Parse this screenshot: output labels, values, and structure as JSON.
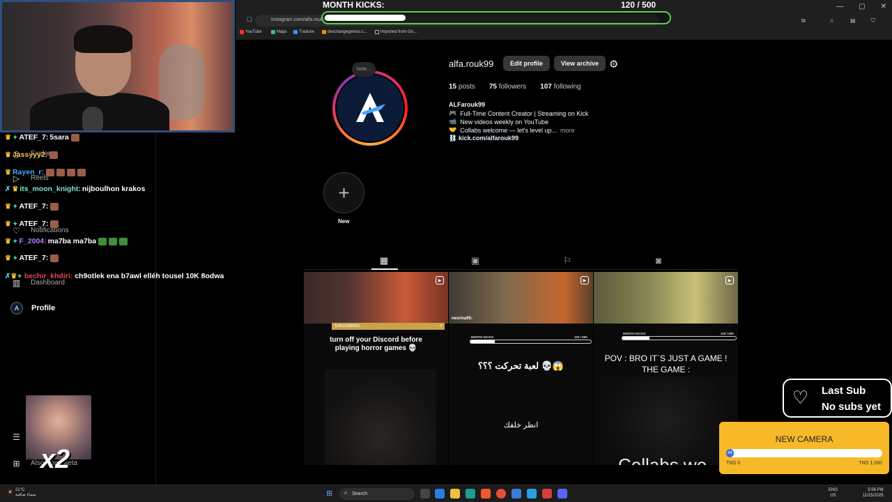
{
  "browser": {
    "url": "instagram.com/alfa.rouk99",
    "bookmarks": [
      "YouTube",
      "Maps",
      "Traduire",
      "dexchangegenius.c...",
      "Imported from Go..."
    ]
  },
  "month_kicks": {
    "label": "MONTH KICKS:",
    "count_text": "120 / 500",
    "current": 120,
    "goal": 500
  },
  "chat": [
    {
      "user": "ATEF_7:",
      "user_color": "#ffffff",
      "msg": "5sara"
    },
    {
      "user": "Jassyyy2:",
      "user_color": "#f0c14b",
      "msg": ""
    },
    {
      "user": "Rayen_r:",
      "user_color": "#4aa8ff",
      "msg": ""
    },
    {
      "user": "its_moon_knight:",
      "user_color": "#79e6d0",
      "msg": "nijboulhon krakos"
    },
    {
      "user": "ATEF_7:",
      "user_color": "#ffffff",
      "msg": ""
    },
    {
      "user": "ATEF_7:",
      "user_color": "#ffffff",
      "msg": ""
    },
    {
      "user": "F_2004:",
      "user_color": "#b57cff",
      "msg": "ma7ba ma7ba"
    },
    {
      "user": "ATEF_7:",
      "user_color": "#ffffff",
      "msg": ""
    },
    {
      "user": "bechir_khdiri:",
      "user_color": "#e0494f",
      "msg": "ch9otlek ena b7awl elléh tousel 10K 8odwa"
    }
  ],
  "sidebar": {
    "explore": "Explore",
    "reels": "Reels",
    "messages": "Messages",
    "notifications": "Notifications",
    "dashboard": "Dashboard",
    "profile": "Profile",
    "also_from_meta": "Also from Meta"
  },
  "profile": {
    "username": "alfa.rouk99",
    "edit_profile": "Edit profile",
    "view_archive": "View archive",
    "note": "Note...",
    "posts_count": "15",
    "posts_label": "posts",
    "followers_count": "75",
    "followers_label": "followers",
    "following_count": "107",
    "following_label": "following",
    "bio_name": "ALFarouk99",
    "bio_lines": [
      {
        "icon": "🎮",
        "text": "Full-Time Content Creator | Streaming on Kick"
      },
      {
        "icon": "📹",
        "text": "New videos weekly on YouTube"
      },
      {
        "icon": "🤝",
        "text": "Collabs welcome — let's level up...",
        "more": "more"
      }
    ],
    "link": "kick.com/alfarouk99",
    "new_highlight": "New"
  },
  "posts": [
    {
      "caption": "turn off your Discord before playing horror games 💀",
      "subs_label": "SUBSCRIBERS",
      "subs_value": "6"
    },
    {
      "caption": "لعبة تحركت ؟؟؟ 💀😱",
      "caption2": "انظر خلفك",
      "kicks_label": "MONTH KICKS:",
      "kicks_count": "100 / 500",
      "chat_user": "nesrina55:"
    },
    {
      "caption": "POV : BRO IT`S JUST A GAME ! THE GAME :",
      "kicks_label": "MONTH KICKS:",
      "kicks_count": "120 / 500",
      "bottom_text": "Collabs we"
    }
  ],
  "last_sub": {
    "title": "Last Sub",
    "subtitle": "No subs yet"
  },
  "new_camera": {
    "title": "NEW CAMERA",
    "current_text": "TND 0",
    "goal_text": "TND 1,000",
    "fill_label": "44",
    "progress": 0.04
  },
  "small_cam": {
    "multiplier": "x2"
  },
  "taskbar": {
    "weather_temp": "21°C",
    "weather_desc": "سماء صافية",
    "search": "Search",
    "lang": "ENG",
    "region": "US",
    "time": "5:56 PM",
    "date": "11/15/2025"
  }
}
